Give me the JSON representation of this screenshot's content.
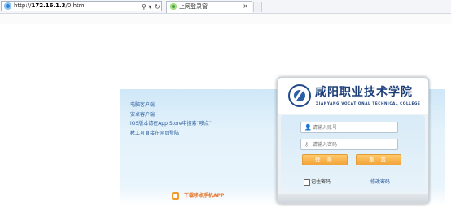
{
  "browser": {
    "url_prefix": "http://",
    "url_host": "172.16.1.3",
    "url_path": "/0.htm",
    "search_glyph": "⚲ ▾",
    "refresh_glyph": "↻",
    "tab_title": "上网登录窗",
    "tab_close": "×"
  },
  "info_links": [
    "电脑客户端",
    "安卓客户端",
    "iOS版本请在App Store中搜索“哆点”",
    "教工可直接在网页登陆"
  ],
  "app_download": "下载哆点手机APP",
  "login": {
    "school_name_cn": "咸阳职业技术学院",
    "school_name_en": "XIANYANG VOCATIONAL TECHNICAL COLLEGE",
    "account_placeholder": "请输入账号",
    "password_placeholder": "请输入密码",
    "login_button": "登 录",
    "reset_button": "重 置",
    "remember_label": "记住密码",
    "change_password": "修改密码"
  },
  "colors": {
    "accent_orange": "#f3a43a",
    "link_blue": "#2a5b9c",
    "brand_navy": "#1c3f7a"
  }
}
